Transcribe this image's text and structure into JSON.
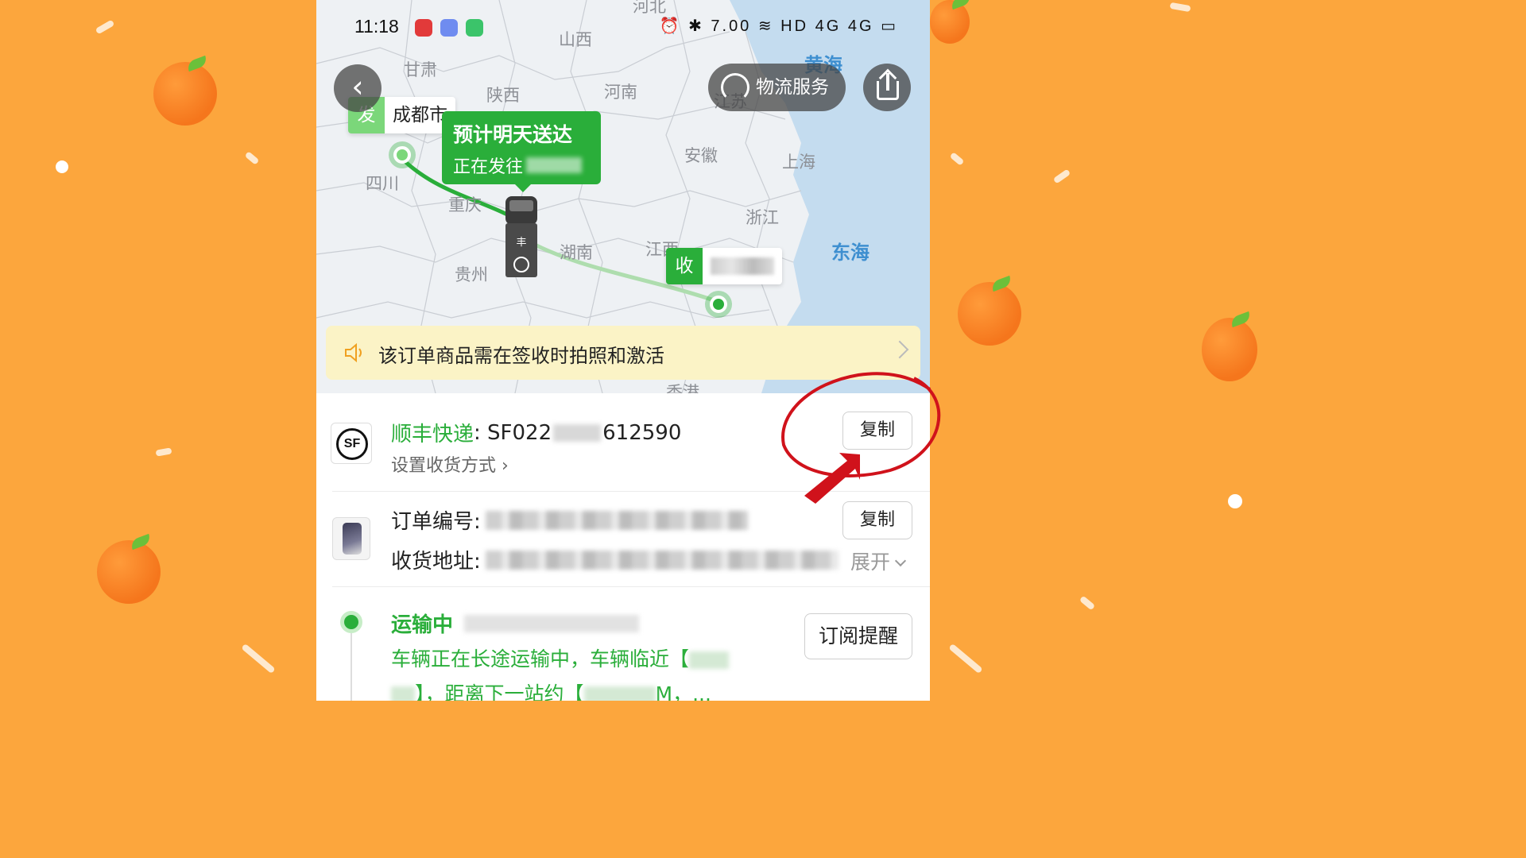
{
  "status_bar": {
    "time": "11:18",
    "icons": "⏰ ✱ 7.00 ≋ HD 4G 4G ▭",
    "speed": "7.00 KB/S"
  },
  "map": {
    "provinces": [
      "河北",
      "山西",
      "甘肃",
      "陕西",
      "河南",
      "江苏",
      "安徽",
      "上海",
      "四川",
      "重庆",
      "湖南",
      "江西",
      "浙江",
      "贵州",
      "香港"
    ],
    "seas": [
      "黄海",
      "东海"
    ],
    "origin_badge": "发",
    "origin_city": "成都市",
    "dest_badge": "收",
    "eta_title": "预计明天送达",
    "eta_sub": "正在发往"
  },
  "header": {
    "service_label": "物流服务"
  },
  "notice": {
    "text": "该订单商品需在签收时拍照和激活"
  },
  "shipment": {
    "courier_name": "顺丰快递",
    "tracking_prefix": ": SF022",
    "tracking_suffix": "612590",
    "set_receive": "设置收货方式 ›",
    "copy_label": "复制",
    "logo_text": "SF"
  },
  "order": {
    "order_no_label": "订单编号:",
    "address_label": "收货地址:",
    "copy_label": "复制",
    "expand_label": "展开"
  },
  "tracking": {
    "status": "运输中",
    "desc_1": "车辆正在长途运输中，车辆临近【",
    "desc_2": "】，距离下一站约【",
    "desc_3": "M，...",
    "subscribe_label": "订阅提醒"
  },
  "colors": {
    "accent_green": "#2AAE3A",
    "background_orange": "#FCA63D",
    "notice_yellow": "#FBF3C6",
    "annotation_red": "#D0121B"
  }
}
